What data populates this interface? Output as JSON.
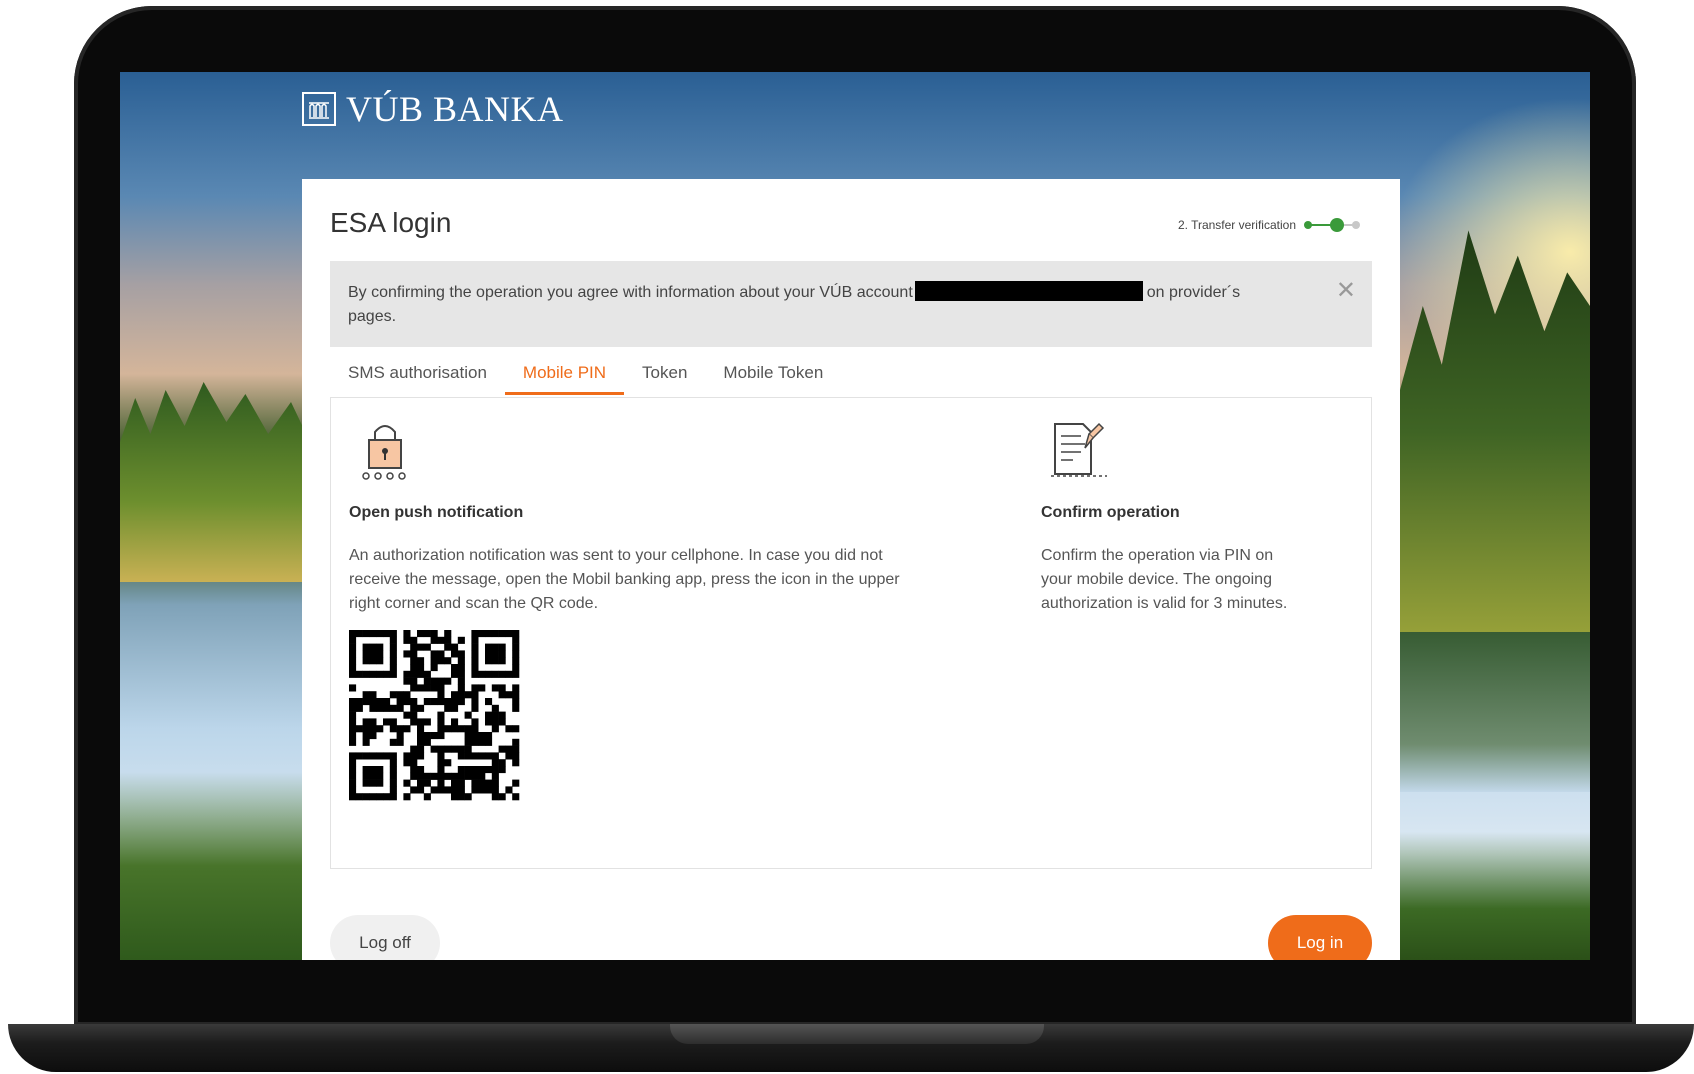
{
  "brand": {
    "logo_text": "VÚB BANKA",
    "icon": "bank-building-icon"
  },
  "card": {
    "title": "ESA login",
    "progress_label": "2. Transfer verification",
    "info": {
      "text_before": "By confirming the operation you agree with information about your VÚB account",
      "text_after": "on provider´s pages.",
      "close_icon": "close-icon"
    },
    "tabs": [
      {
        "label": "SMS authorisation",
        "active": false
      },
      {
        "label": "Mobile PIN",
        "active": true
      },
      {
        "label": "Token",
        "active": false
      },
      {
        "label": "Mobile Token",
        "active": false
      }
    ],
    "steps": [
      {
        "icon": "padlock-pin-icon",
        "title": "Open push notification",
        "text": "An authorization notification was sent to your cellphone. In case you did not receive the message, open the Mobil banking app, press the icon in the upper right corner and scan the QR code."
      },
      {
        "icon": "document-sign-icon",
        "title": "Confirm operation",
        "text": "Confirm the operation via PIN on your mobile device. The ongoing authorization is valid for 3 minutes."
      }
    ],
    "buttons": {
      "logoff": "Log off",
      "login": "Log in"
    }
  },
  "colors": {
    "accent": "#ef6c1a",
    "progress": "#3a9a3a"
  }
}
